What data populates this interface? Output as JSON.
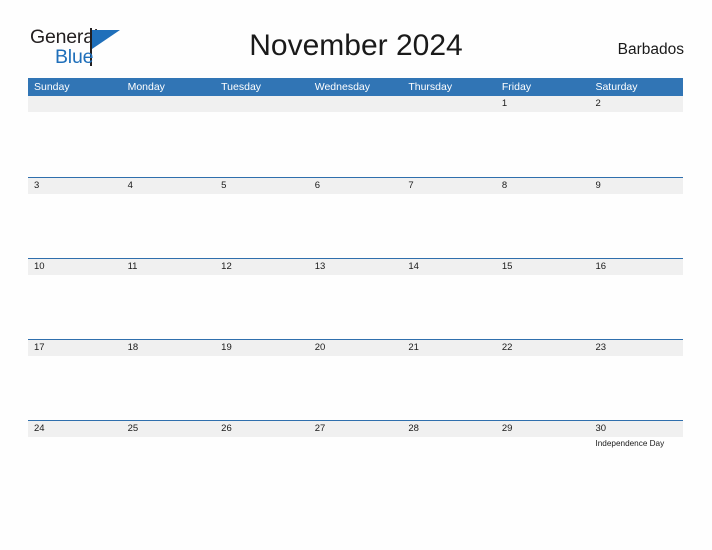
{
  "logo": {
    "word_one": "General",
    "word_two": "Blue",
    "triangle_icon": "flag-triangle-icon",
    "accent_color": "#1f6fba"
  },
  "header": {
    "title": "November 2024",
    "country": "Barbados"
  },
  "theme": {
    "header_blue": "#3175b5",
    "row_divider_blue": "#2f6fad",
    "band_gray": "#f0f0f0",
    "page_background": "#fefefe",
    "text_dark": "#1a1a1a"
  },
  "calendar": {
    "month": "November",
    "year": "2024",
    "weekday_headers": [
      "Sunday",
      "Monday",
      "Tuesday",
      "Wednesday",
      "Thursday",
      "Friday",
      "Saturday"
    ],
    "weeks": [
      [
        {
          "day": "",
          "event": ""
        },
        {
          "day": "",
          "event": ""
        },
        {
          "day": "",
          "event": ""
        },
        {
          "day": "",
          "event": ""
        },
        {
          "day": "",
          "event": ""
        },
        {
          "day": "1",
          "event": ""
        },
        {
          "day": "2",
          "event": ""
        }
      ],
      [
        {
          "day": "3",
          "event": ""
        },
        {
          "day": "4",
          "event": ""
        },
        {
          "day": "5",
          "event": ""
        },
        {
          "day": "6",
          "event": ""
        },
        {
          "day": "7",
          "event": ""
        },
        {
          "day": "8",
          "event": ""
        },
        {
          "day": "9",
          "event": ""
        }
      ],
      [
        {
          "day": "10",
          "event": ""
        },
        {
          "day": "11",
          "event": ""
        },
        {
          "day": "12",
          "event": ""
        },
        {
          "day": "13",
          "event": ""
        },
        {
          "day": "14",
          "event": ""
        },
        {
          "day": "15",
          "event": ""
        },
        {
          "day": "16",
          "event": ""
        }
      ],
      [
        {
          "day": "17",
          "event": ""
        },
        {
          "day": "18",
          "event": ""
        },
        {
          "day": "19",
          "event": ""
        },
        {
          "day": "20",
          "event": ""
        },
        {
          "day": "21",
          "event": ""
        },
        {
          "day": "22",
          "event": ""
        },
        {
          "day": "23",
          "event": ""
        }
      ],
      [
        {
          "day": "24",
          "event": ""
        },
        {
          "day": "25",
          "event": ""
        },
        {
          "day": "26",
          "event": ""
        },
        {
          "day": "27",
          "event": ""
        },
        {
          "day": "28",
          "event": ""
        },
        {
          "day": "29",
          "event": ""
        },
        {
          "day": "30",
          "event": "Independence Day"
        }
      ]
    ]
  }
}
